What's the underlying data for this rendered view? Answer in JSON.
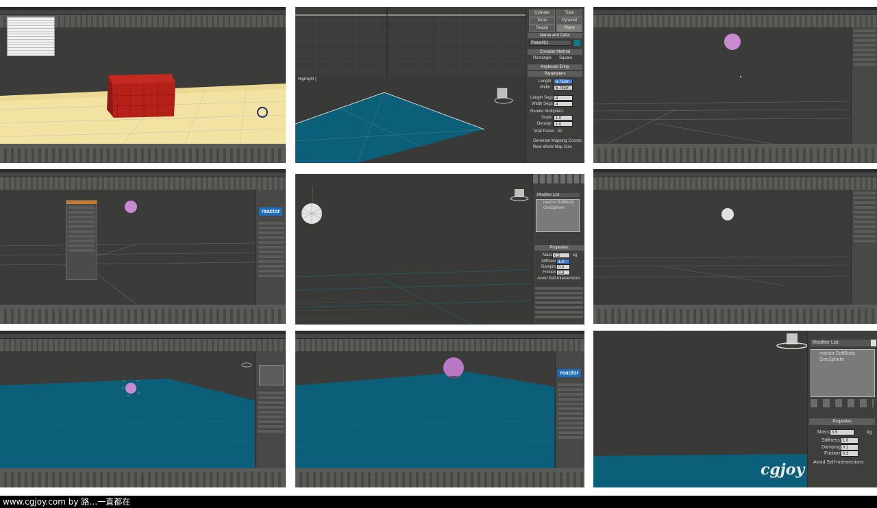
{
  "caption": {
    "text": "www.cgjoy.com by 路…一直都在"
  },
  "panel2": {
    "buttons": [
      "Cylinder",
      "Tube",
      "Torus",
      "Pyramid",
      "Teapot",
      "Plane"
    ],
    "name_and_color": "Name and Color",
    "object_name": "Plane001",
    "creation_method": "Creation Method",
    "rectangle": "Rectangle",
    "square": "Square",
    "keyboard_entry": "Keyboard Entry",
    "parameters": "Parameters",
    "length_label": "Length:",
    "length_value": "6.752m",
    "width_label": "Width:",
    "width_value": "6.752m",
    "length_segs_label": "Length Segs:",
    "length_segs_value": "4",
    "width_segs_label": "Width Segs:",
    "width_segs_value": "4",
    "render_multipliers": "Render Multipliers",
    "scale_label": "Scale:",
    "scale_value": "1.0",
    "density_label": "Density:",
    "density_value": "1.0",
    "total_faces": "Total Faces : 32",
    "gen_mapping": "Generate Mapping Coords.",
    "real_world": "Real-World Map Size",
    "viewport_label": "Highlight ]"
  },
  "panel5": {
    "modifier_list": "Modifier List",
    "stack_item1": "reactor SoftBody",
    "stack_item2": "GeoSphere",
    "properties": "Properties",
    "mass_label": "Mass:",
    "mass_value": "0.5",
    "mass_unit": "kg",
    "stiffness_label": "Stiffness:",
    "stiffness_value": "1.0",
    "damping_label": "Damping:",
    "damping_value": "0.2",
    "friction_label": "Friction:",
    "friction_value": "0.3",
    "avoid_self": "Avoid Self-Intersections"
  },
  "panel9": {
    "modifier_list": "Modifier List",
    "stack_item1": "reactor SoftBody",
    "stack_item2": "GeoSphere",
    "properties": "Properties",
    "mass_label": "Mass:",
    "mass_value": "0.5",
    "mass_unit": "kg",
    "stiffness_label": "Stiffness:",
    "stiffness_value": "1.0",
    "damping_label": "Damping:",
    "damping_value": "0.2",
    "friction_label": "Friction:",
    "friction_value": "0.3",
    "avoid_self": "Avoid Self-Intersections"
  },
  "reactor_logo": "reactor",
  "watermark": {
    "logo": "cgjoy"
  },
  "colors": {
    "viewport_bg": "#3b3b39",
    "water_plane": "#0b5f78",
    "selected_field": "#3d7fd6",
    "sphere": "#c98bd0"
  }
}
